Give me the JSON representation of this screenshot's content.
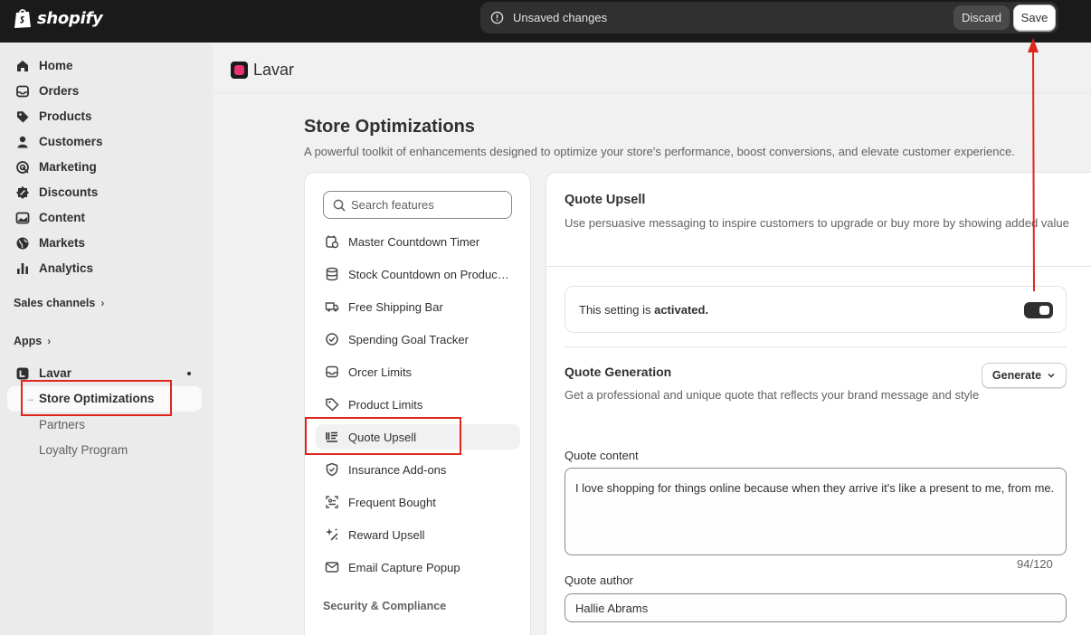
{
  "topbar": {
    "brand": "shopify",
    "unsaved_text": "Unsaved changes",
    "discard_label": "Discard",
    "save_label": "Save"
  },
  "sidebar": {
    "items": [
      {
        "label": "Home",
        "icon": "home-icon"
      },
      {
        "label": "Orders",
        "icon": "inbox-icon"
      },
      {
        "label": "Products",
        "icon": "tag-icon"
      },
      {
        "label": "Customers",
        "icon": "person-icon"
      },
      {
        "label": "Marketing",
        "icon": "target-icon"
      },
      {
        "label": "Discounts",
        "icon": "discount-icon"
      },
      {
        "label": "Content",
        "icon": "image-icon"
      },
      {
        "label": "Markets",
        "icon": "globe-icon"
      },
      {
        "label": "Analytics",
        "icon": "bar-chart-icon"
      }
    ],
    "sales_channels": "Sales channels",
    "apps": "Apps",
    "app_name": "Lavar",
    "app_sub": [
      "Store Optimizations",
      "Partners",
      "Loyalty Program"
    ]
  },
  "header": {
    "app_title": "Lavar"
  },
  "page": {
    "title": "Store Optimizations",
    "description": "A powerful toolkit of enhancements designed to optimize your store's performance, boost conversions, and elevate customer experience."
  },
  "search": {
    "placeholder": "Search features"
  },
  "features": [
    {
      "label": "Master Countdown Timer",
      "icon": "timer-icon"
    },
    {
      "label": "Stock Countdown on Product Page",
      "icon": "database-icon"
    },
    {
      "label": "Free Shipping Bar",
      "icon": "truck-icon"
    },
    {
      "label": "Spending Goal Tracker",
      "icon": "check-circle-icon"
    },
    {
      "label": "Orcer Limits",
      "icon": "inbox-icon"
    },
    {
      "label": "Product Limits",
      "icon": "tag-icon"
    },
    {
      "label": "Quote Upsell",
      "icon": "text-align-icon"
    },
    {
      "label": "Insurance Add-ons",
      "icon": "shield-check-icon"
    },
    {
      "label": "Frequent Bought",
      "icon": "grid-icon"
    },
    {
      "label": "Reward Upsell",
      "icon": "sparkle-icon"
    },
    {
      "label": "Email Capture Popup",
      "icon": "email-icon"
    }
  ],
  "features_group": "Security & Compliance",
  "detail": {
    "title": "Quote Upsell",
    "description": "Use persuasive messaging to inspire customers to upgrade or buy more by showing added value",
    "activation_prefix": "This setting is ",
    "activation_state": "activated.",
    "toggle_on": true,
    "quote_generation_title": "Quote Generation",
    "quote_generation_desc": "Get a professional and unique quote that reflects your brand message and style",
    "generate_label": "Generate",
    "quote_content_label": "Quote content",
    "quote_content_value": "I love shopping for things online because when they arrive it's like a present to me, from me.",
    "char_count": "94/120",
    "quote_author_label": "Quote author",
    "quote_author_value": "Hallie Abrams"
  },
  "annotation_color": "#e0261b"
}
